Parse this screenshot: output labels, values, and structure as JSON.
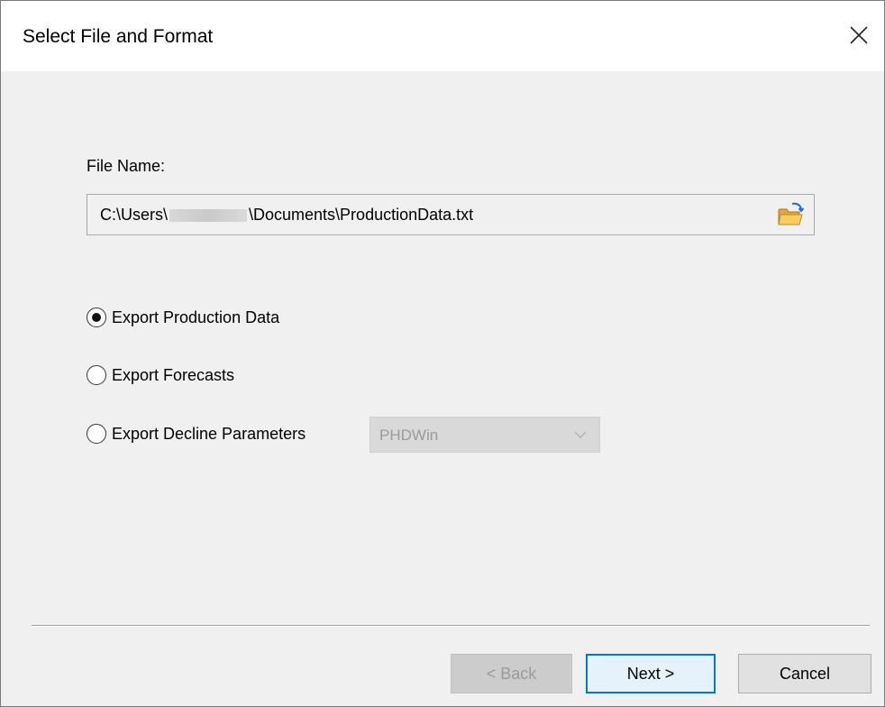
{
  "window": {
    "title": "Select File and Format"
  },
  "file": {
    "label": "File Name:",
    "path_prefix": "C:\\Users\\",
    "path_suffix": "\\Documents\\ProductionData.txt"
  },
  "options": {
    "export_production": "Export Production Data",
    "export_forecasts": "Export Forecasts",
    "export_decline": "Export Decline Parameters",
    "selected": "export_production"
  },
  "decline_format": {
    "value": "PHDWin",
    "disabled": true
  },
  "buttons": {
    "back": "< Back",
    "next": "Next >",
    "cancel": "Cancel"
  },
  "colors": {
    "accent": "#0078d7",
    "dialog_bg": "#f0f0f0",
    "disabled_text": "#9a9a9a"
  }
}
